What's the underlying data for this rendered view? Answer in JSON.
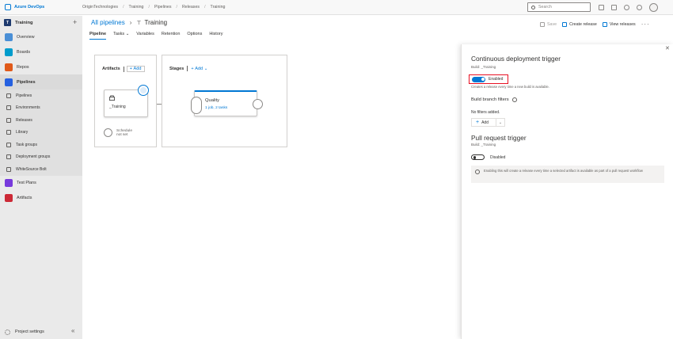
{
  "app": {
    "brand": "Azure DevOps"
  },
  "breadcrumb": [
    "OriginTechnologies",
    "Training",
    "Pipelines",
    "Releases",
    "Training"
  ],
  "search": {
    "placeholder": "Search"
  },
  "sidebar": {
    "project_initial": "T",
    "project_name": "Training",
    "items": [
      {
        "label": "Overview",
        "color": "#4a8fd6"
      },
      {
        "label": "Boards",
        "color": "#009ccc"
      },
      {
        "label": "Repos",
        "color": "#e05a1a"
      },
      {
        "label": "Pipelines",
        "color": "#2560e0"
      }
    ],
    "sub_items": [
      "Pipelines",
      "Environments",
      "Releases",
      "Library",
      "Task groups",
      "Deployment groups",
      "WhiteSource Bolt"
    ],
    "more_items": [
      {
        "label": "Test Plans",
        "color": "#773adc"
      },
      {
        "label": "Artifacts",
        "color": "#cc2936"
      }
    ],
    "settings_label": "Project settings"
  },
  "header": {
    "all_pipelines": "All pipelines",
    "pipeline_name": "Training",
    "save": "Save",
    "create_release": "Create release",
    "view_releases": "View releases",
    "more": "···"
  },
  "tabs": [
    "Pipeline",
    "Tasks",
    "Variables",
    "Retention",
    "Options",
    "History"
  ],
  "canvas": {
    "artifacts_label": "Artifacts",
    "add": "Add",
    "artifact_name": "_Training",
    "schedule_line1": "Schedule",
    "schedule_line2": "not set",
    "stages_label": "Stages",
    "stage_name": "Quality",
    "stage_detail": "1 job, 2 tasks"
  },
  "flyout": {
    "cd_title": "Continuous deployment trigger",
    "cd_subtitle": "Build: _Training",
    "toggle_label": "Enabled",
    "cd_desc": "Creates a release every time a new build is available.",
    "branch_filters": "Build branch filters",
    "no_filters": "No filters added.",
    "add": "Add",
    "pr_title": "Pull request trigger",
    "pr_subtitle": "Build: _Training",
    "pr_toggle_label": "Disabled",
    "pr_note": "Enabling this will create a release every time a selected artifact is available as part of a pull request workflow"
  }
}
